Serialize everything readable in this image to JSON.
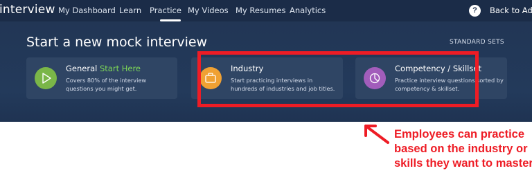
{
  "nav": {
    "brand": "interview",
    "items": [
      {
        "label": "My Dashboard",
        "active": false
      },
      {
        "label": "Learn",
        "active": false
      },
      {
        "label": "Practice",
        "active": true
      },
      {
        "label": "My Videos",
        "active": false
      },
      {
        "label": "My Resumes",
        "active": false
      },
      {
        "label": "Analytics",
        "active": false
      }
    ],
    "help": "?",
    "back": "Back to Admin"
  },
  "hero": {
    "title": "Start a new mock interview",
    "sets_label": "STANDARD SETS",
    "cards": [
      {
        "title": "General",
        "accent": "Start Here",
        "desc_lines": [
          "Covers 80% of the interview",
          "questions you might get."
        ],
        "icon": "play-icon",
        "color": "#7ab648"
      },
      {
        "title": "Industry",
        "desc_lines": [
          "Start practicing interviews in",
          "hundreds of industries and job titles."
        ],
        "icon": "briefcase-icon",
        "color": "#f0a133"
      },
      {
        "title": "Competency / Skillset",
        "desc_lines": [
          "Practice interview questions sorted by",
          "competency & skillset."
        ],
        "icon": "pie-chart-icon",
        "color": "#a25dbb"
      }
    ]
  },
  "annotation": {
    "lines": [
      "Employees can practice",
      "based on the industry or",
      "skills they want to master"
    ],
    "color": "#ee1c25"
  }
}
